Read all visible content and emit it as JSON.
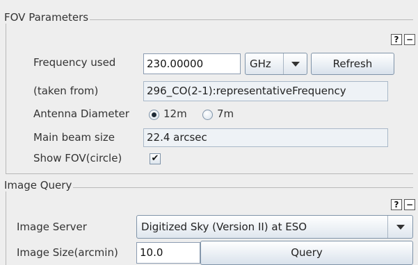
{
  "fov": {
    "title": "FOV Parameters",
    "help_label": "?",
    "collapse_label": "−",
    "frequency_label": "Frequency used",
    "frequency_value": "230.00000",
    "unit_selected": "GHz",
    "refresh_label": "Refresh",
    "taken_from_label": "(taken from)",
    "taken_from_value": "296_CO(2-1):representativeFrequency",
    "antenna_label": "Antenna Diameter",
    "antenna_options": [
      "12m",
      "7m"
    ],
    "antenna_selected": "12m",
    "beam_label": "Main beam size",
    "beam_value": "22.4 arcsec",
    "show_fov_label": "Show FOV(circle)",
    "show_fov_checked": true,
    "check_mark": "✔"
  },
  "image_query": {
    "title": "Image Query",
    "help_label": "?",
    "collapse_label": "−",
    "server_label": "Image Server",
    "server_selected": "Digitized Sky (Version II) at ESO",
    "size_label": "Image Size(arcmin)",
    "size_value": "10.0",
    "query_label": "Query"
  }
}
